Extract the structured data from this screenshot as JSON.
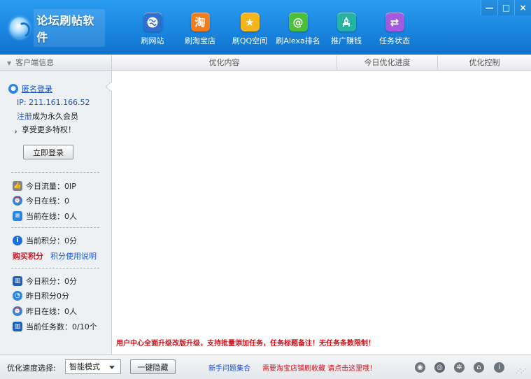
{
  "app": {
    "title": "论坛刷帖软件"
  },
  "nav": [
    {
      "label": "刷网站",
      "icon": "globe-icon",
      "color": "#2f6fd0"
    },
    {
      "label": "刷淘宝店",
      "icon": "taobao-icon",
      "color": "#f07d1e"
    },
    {
      "label": "刷QQ空间",
      "icon": "star-icon",
      "color": "#f2b51c"
    },
    {
      "label": "刷Alexa排名",
      "icon": "at-icon",
      "color": "#4cbf3a"
    },
    {
      "label": "推广赚钱",
      "icon": "rocket-icon",
      "color": "#24b3a5"
    },
    {
      "label": "任务状态",
      "icon": "arrows-icon",
      "color": "#a35ae0"
    }
  ],
  "window": {
    "minimize": "—",
    "maximize": "□",
    "close": "×"
  },
  "sidebar": {
    "header": "客户端信息",
    "anonymous_login": "匿名登录",
    "ip": "IP: 211.161.166.52",
    "register_link": "注册",
    "register_text": "成为永久会员",
    "privilege_text": "，享受更多特权！",
    "login_button": "立即登录",
    "today_traffic": "今日流量：0IP",
    "today_online": "今日在线：0",
    "current_online": "当前在线：0人",
    "current_points": "当前积分：0分",
    "buy_points": "购买积分",
    "points_help": "积分使用说明",
    "today_points": "今日积分：0分",
    "yesterday_points": "昨日积分0分",
    "yesterday_online": "昨日在线：0人",
    "today_tasks": "当前任务数：0/10个"
  },
  "table": {
    "columns": [
      "优化内容",
      "今日优化进度",
      "优化控制"
    ],
    "notice": "用户中心全面升级改版升级，支持批量添加任务，任务标题备注！无任务条数限制！"
  },
  "footer": {
    "speed_label": "优化速度选择:",
    "speed_value": "智能模式",
    "hide_button": "一键隐藏",
    "faq_link": "新手问题集合",
    "promo_link": "需要淘宝店铺刷收藏 请点击这里哦！",
    "icons": [
      "ball-icon",
      "eye-icon",
      "gear-icon",
      "home-icon",
      "info-icon"
    ]
  }
}
